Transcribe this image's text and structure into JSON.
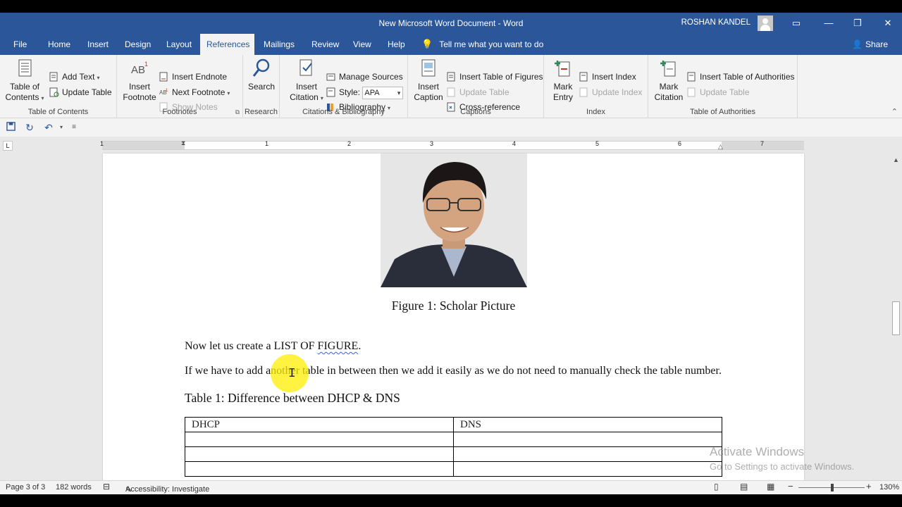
{
  "window": {
    "title": "New Microsoft Word Document  -  Word",
    "user": "ROSHAN KANDEL",
    "controls": {
      "ribbon_display": "▭",
      "minimize": "—",
      "maximize": "❐",
      "close": "✕"
    }
  },
  "tabs": [
    "File",
    "Home",
    "Insert",
    "Design",
    "Layout",
    "References",
    "Mailings",
    "Review",
    "View",
    "Help"
  ],
  "tell_me": "Tell me what you want to do",
  "share": "Share",
  "ribbon": {
    "toc": {
      "big": "Table of\nContents",
      "add_text": "Add Text",
      "update_table": "Update Table",
      "label": "Table of Contents"
    },
    "footnotes": {
      "big": "Insert\nFootnote",
      "insert_endnote": "Insert Endnote",
      "next_footnote": "Next Footnote",
      "show_notes": "Show Notes",
      "label": "Footnotes"
    },
    "research": {
      "big": "Search",
      "label": "Research"
    },
    "citations": {
      "big": "Insert\nCitation",
      "manage_sources": "Manage Sources",
      "style_label": "Style:",
      "style_value": "APA",
      "bibliography": "Bibliography",
      "label": "Citations & Bibliography"
    },
    "captions": {
      "big": "Insert\nCaption",
      "insert_tof": "Insert Table of Figures",
      "update_table": "Update Table",
      "cross_reference": "Cross-reference",
      "label": "Captions"
    },
    "index": {
      "big": "Mark\nEntry",
      "insert_index": "Insert Index",
      "update_index": "Update Index",
      "label": "Index"
    },
    "toa": {
      "big": "Mark\nCitation",
      "insert_toa": "Insert Table of Authorities",
      "update_table": "Update Table",
      "label": "Table of Authorities"
    }
  },
  "ruler": {
    "numbers": [
      "1",
      "1",
      "2",
      "3",
      "4",
      "5",
      "6",
      "7"
    ]
  },
  "document": {
    "figure_caption": "Figure 1: Scholar Picture",
    "para1_before": "Now let us create a LIST OF ",
    "para1_squiggle": "FIGURE",
    "para1_after": ".",
    "para2": "If we have to add another table in between then we add it easily as we do not need to manually check the table number.",
    "table_caption": "Table 1: Difference between DHCP & DNS",
    "table": {
      "headers": [
        "DHCP",
        "DNS"
      ],
      "rows": [
        [
          "",
          ""
        ],
        [
          "",
          ""
        ],
        [
          "",
          ""
        ]
      ]
    }
  },
  "watermark": {
    "line1": "Activate Windows",
    "line2": "Go to Settings to activate Windows."
  },
  "status": {
    "page": "Page 3 of 3",
    "words": "182 words",
    "accessibility": "Accessibility: Investigate",
    "zoom_out": "−",
    "zoom_in": "+",
    "zoom": "130%",
    "zoom_level": 1.3
  }
}
